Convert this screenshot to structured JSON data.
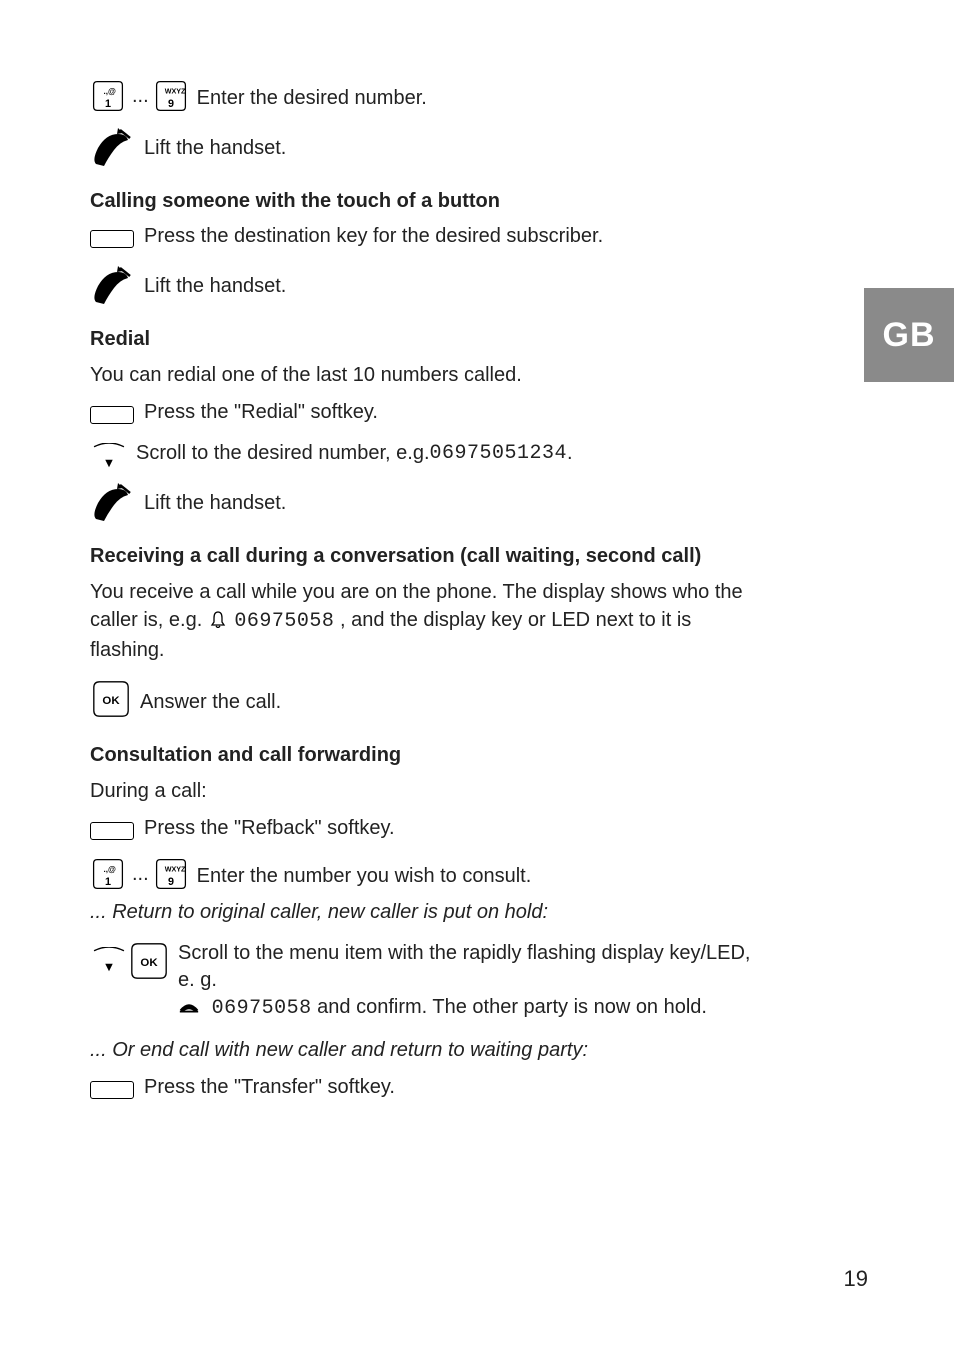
{
  "side_tab": "GB",
  "page_number": "19",
  "s1": {
    "enter_number": "Enter the desired number.",
    "lift_handset": "Lift the handset."
  },
  "s2": {
    "heading": "Calling someone with the touch of a button",
    "press_dest": "Press the destination key for the desired subscriber.",
    "lift_handset": "Lift the handset."
  },
  "s3": {
    "heading": "Redial",
    "intro": "You can redial one of the last 10 numbers called.",
    "press_redial": "Press the \"Redial\" softkey.",
    "scroll_pre": "Scroll to the desired number, e.g. ",
    "scroll_num": "06975051234",
    "scroll_post": ".",
    "lift_handset": "Lift the handset."
  },
  "s4": {
    "heading": "Receiving a call during a conversation (call waiting, second call)",
    "intro_pre": "You receive a call while you are on the phone. The display shows who the caller is, e.g.",
    "intro_num": "06975058",
    "intro_post": ", and the display key or LED next to it is flashing.",
    "answer": "Answer the call."
  },
  "s5": {
    "heading": "Consultation and call forwarding",
    "during": "During a call:",
    "press_refback": "Press the \"Refback\" softkey.",
    "enter_consult": "Enter the number you wish to consult.",
    "return_original": "... Return to original caller, new caller is put on hold:",
    "scroll_menu_pre": "Scroll to the menu item with the rapidly flashing display key/LED, e. g. ",
    "scroll_menu_num": "06975058",
    "scroll_menu_post": " and confirm. The other party is now on hold.",
    "or_end": "...  Or end call with new caller and return to waiting party:",
    "press_transfer": "Press the \"Transfer\" softkey."
  }
}
